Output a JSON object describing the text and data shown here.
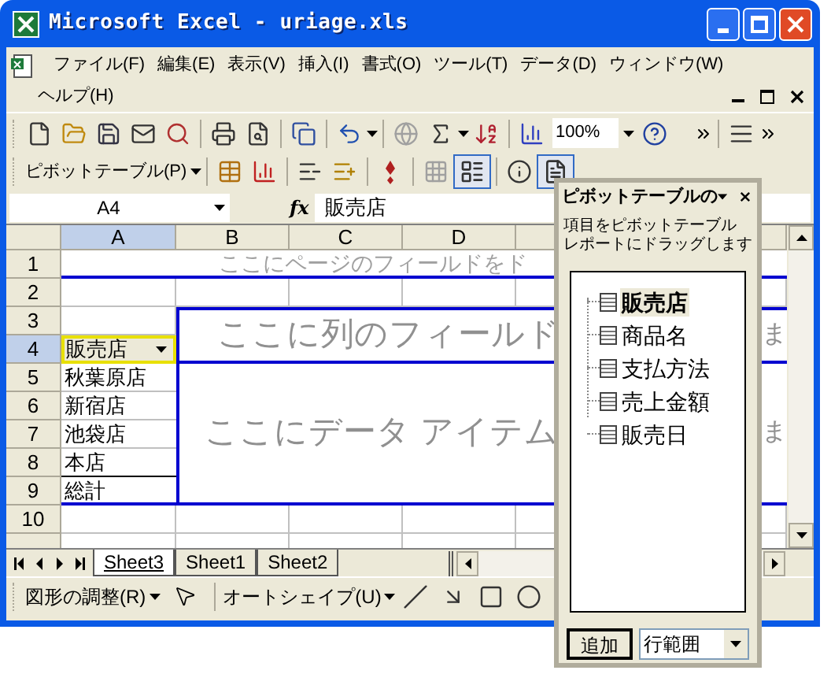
{
  "window": {
    "title": "Microsoft Excel - uriage.xls"
  },
  "menu": [
    "ファイル(F)",
    "編集(E)",
    "表示(V)",
    "挿入(I)",
    "書式(O)",
    "ツール(T)",
    "データ(D)",
    "ウィンドウ(W)",
    "ヘルプ(H)"
  ],
  "toolbar": {
    "zoom": "100%"
  },
  "pivot_toolbar": {
    "menu": "ピボットテーブル(P)",
    "always_show_items": {
      "pressed": true
    },
    "field_list": {
      "pressed": true
    }
  },
  "formula_bar": {
    "name_box": "A4",
    "fx": "fx",
    "formula": "販売店"
  },
  "grid": {
    "columns": [
      {
        "label": "A",
        "selected": true
      },
      {
        "label": "B",
        "selected": false
      },
      {
        "label": "C",
        "selected": false
      },
      {
        "label": "D",
        "selected": false
      }
    ],
    "rows": [
      {
        "label": "1",
        "selected": false
      },
      {
        "label": "2",
        "selected": false
      },
      {
        "label": "3",
        "selected": false
      },
      {
        "label": "4",
        "selected": true
      },
      {
        "label": "5",
        "selected": false
      },
      {
        "label": "6",
        "selected": false
      },
      {
        "label": "7",
        "selected": false
      },
      {
        "label": "8",
        "selected": false
      },
      {
        "label": "9",
        "selected": false
      },
      {
        "label": "10",
        "selected": false
      }
    ],
    "page_area": "ここにページのフィールドをド",
    "column_area": [
      "ここに列のフィールド",
      "ま"
    ],
    "data_area": [
      "ここにデータ アイテム",
      "ま"
    ],
    "row_field": {
      "label": "販売店",
      "items": [
        "秋葉原店",
        "新宿店",
        "池袋店",
        "本店",
        "総計"
      ]
    }
  },
  "sheet_tabs": [
    {
      "label": "Sheet3",
      "selected": true
    },
    {
      "label": "Sheet1",
      "selected": false
    },
    {
      "label": "Sheet2",
      "selected": false
    }
  ],
  "drawing_toolbar": {
    "draw_menu": "図形の調整(R)",
    "autoshape_menu": "オートシェイプ(U)"
  },
  "pivot_panel": {
    "title": "ピボットテーブルの",
    "instructions": [
      "項目をピボットテーブル",
      "レポートにドラッグします"
    ],
    "fields": [
      {
        "label": "販売店",
        "selected": true
      },
      {
        "label": "商品名",
        "selected": false
      },
      {
        "label": "支払方法",
        "selected": false
      },
      {
        "label": "売上金額",
        "selected": false
      },
      {
        "label": "販売日",
        "selected": false
      }
    ],
    "add_button": "追加",
    "area_select": "行範囲"
  }
}
